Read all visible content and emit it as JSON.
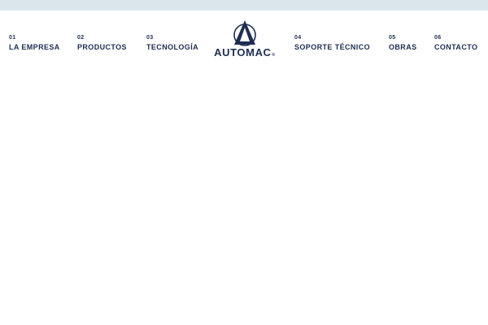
{
  "brand": {
    "name": "AUTOMAC",
    "registered_mark": "®",
    "colors": {
      "navy": "#1e2d52",
      "top_strip": "#dbe5ec",
      "background": "#ffffff"
    }
  },
  "nav": {
    "items": [
      {
        "number": "01",
        "label": "LA EMPRESA"
      },
      {
        "number": "02",
        "label": "PRODUCTOS"
      },
      {
        "number": "03",
        "label": "TECNOLOGÍA"
      },
      {
        "number": "04",
        "label": "SOPORTE TÉCNICO"
      },
      {
        "number": "05",
        "label": "OBRAS"
      },
      {
        "number": "06",
        "label": "CONTACTO"
      }
    ]
  }
}
